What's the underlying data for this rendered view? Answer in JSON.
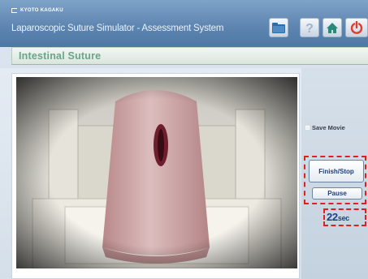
{
  "header": {
    "brand": "KYOTO KAGAKU",
    "title": "Laparoscopic Suture Simulator - Assessment System",
    "buttons": {
      "folder": "folder-icon",
      "help": "help-icon",
      "home": "home-icon",
      "power": "power-icon"
    }
  },
  "section": {
    "title": "Intestinal Suture"
  },
  "video": {
    "description_icon": "camera-feed"
  },
  "controls": {
    "save_movie_label": "Save Movie",
    "finish_stop_label": "Finish/Stop",
    "pause_label": "Pause",
    "timer_value": "22",
    "timer_unit": "sec"
  },
  "colors": {
    "header": "#5f86b1",
    "section_text": "#6aa58a",
    "button_text": "#1d3f7a",
    "highlight": "#e01f1f",
    "power": "#e23b2a"
  }
}
